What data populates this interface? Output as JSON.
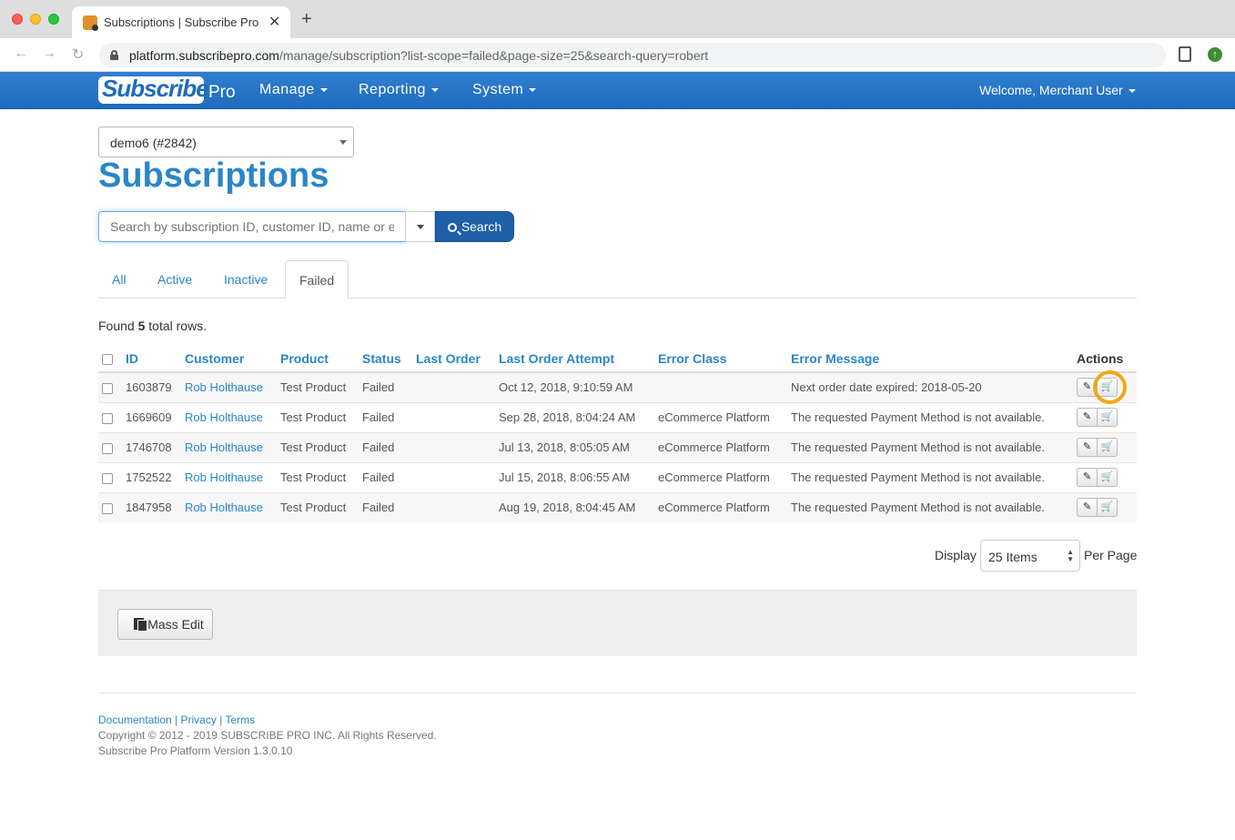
{
  "browser": {
    "tab_title": "Subscriptions | Subscribe Pro I",
    "url_host": "platform.subscribepro.com",
    "url_path": "/manage/subscription?list-scope=failed&page-size=25&search-query=robert"
  },
  "navbar": {
    "logo_text": "Subscribe",
    "logo_suffix": "Pro",
    "menu": [
      "Manage",
      "Reporting",
      "System"
    ],
    "welcome": "Welcome, Merchant User"
  },
  "account_selector": {
    "value": "demo6 (#2842)"
  },
  "page_title": "Subscriptions",
  "search": {
    "placeholder": "Search by subscription ID, customer ID, name or email",
    "button_label": "Search"
  },
  "filter_tabs": [
    {
      "label": "All",
      "active": false
    },
    {
      "label": "Active",
      "active": false
    },
    {
      "label": "Inactive",
      "active": false
    },
    {
      "label": "Failed",
      "active": true
    }
  ],
  "found": {
    "prefix": "Found ",
    "count": "5",
    "suffix": " total rows."
  },
  "table": {
    "columns": [
      "ID",
      "Customer",
      "Product",
      "Status",
      "Last Order",
      "Last Order Attempt",
      "Error Class",
      "Error Message",
      "Actions"
    ],
    "rows": [
      {
        "id": "1603879",
        "customer": "Rob Holthause",
        "product": "Test Product",
        "status": "Failed",
        "last_order": "",
        "last_attempt": "Oct 12, 2018, 9:10:59 AM",
        "error_class": "",
        "error_message": "Next order date expired: 2018-05-20"
      },
      {
        "id": "1669609",
        "customer": "Rob Holthause",
        "product": "Test Product",
        "status": "Failed",
        "last_order": "",
        "last_attempt": "Sep 28, 2018, 8:04:24 AM",
        "error_class": "eCommerce Platform",
        "error_message": "The requested Payment Method is not available."
      },
      {
        "id": "1746708",
        "customer": "Rob Holthause",
        "product": "Test Product",
        "status": "Failed",
        "last_order": "",
        "last_attempt": "Jul 13, 2018, 8:05:05 AM",
        "error_class": "eCommerce Platform",
        "error_message": "The requested Payment Method is not available."
      },
      {
        "id": "1752522",
        "customer": "Rob Holthause",
        "product": "Test Product",
        "status": "Failed",
        "last_order": "",
        "last_attempt": "Jul 15, 2018, 8:06:55 AM",
        "error_class": "eCommerce Platform",
        "error_message": "The requested Payment Method is not available."
      },
      {
        "id": "1847958",
        "customer": "Rob Holthause",
        "product": "Test Product",
        "status": "Failed",
        "last_order": "",
        "last_attempt": "Aug 19, 2018, 8:04:45 AM",
        "error_class": "eCommerce Platform",
        "error_message": "The requested Payment Method is not available."
      }
    ]
  },
  "pagination": {
    "display_label": "Display",
    "page_size": "25 Items",
    "per_page_label": "Per Page"
  },
  "mass_edit": {
    "label": "Mass Edit"
  },
  "footer": {
    "links": [
      "Documentation",
      "Privacy",
      "Terms"
    ],
    "copyright": "Copyright © 2012 - 2019 SUBSCRIBE PRO INC. All Rights Reserved.",
    "version": "Subscribe Pro Platform Version 1.3.0.10"
  }
}
